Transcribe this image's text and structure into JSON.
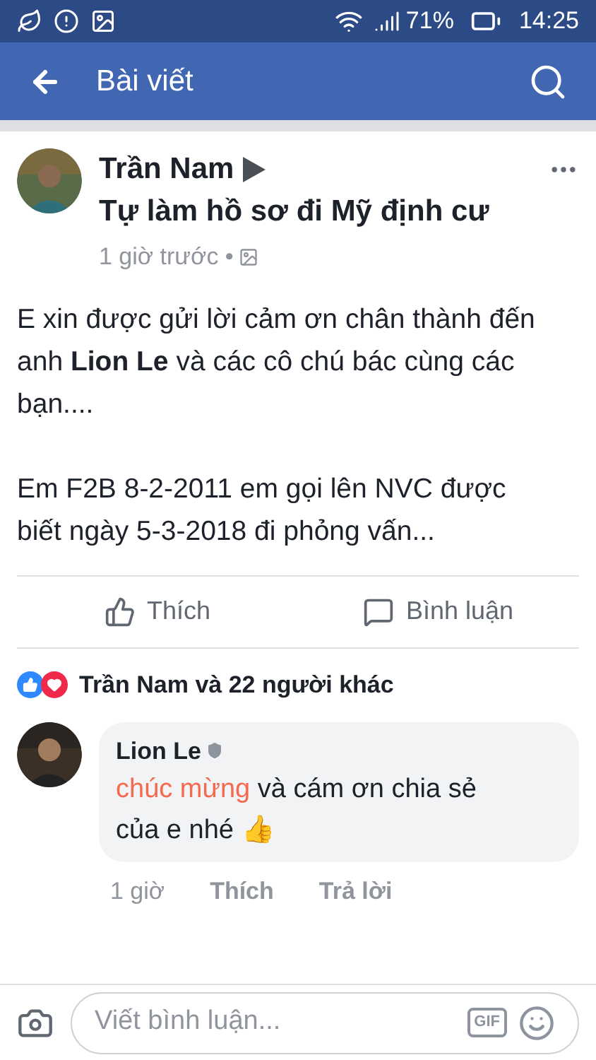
{
  "status_bar": {
    "battery": "71%",
    "time": "14:25"
  },
  "header": {
    "title": "Bài viết"
  },
  "post": {
    "author": "Trần Nam",
    "group": "Tự làm hồ sơ đi Mỹ định cư",
    "time": "1 giờ trước •",
    "paragraphs": [
      "E xin được gửi lời cảm ơn chân thành đến anh **Lion Le** và các cô chú bác cùng các bạn....",
      "Em F2B 8-2-2011 em gọi lên NVC được biết ngày 5-3-2018 đi phỏng vấn..."
    ],
    "actions": [
      "Thích",
      "Bình luận"
    ],
    "reactions": "Trần Nam và 22 người khác"
  },
  "comment": {
    "author": "Lion Le",
    "highlight": "chúc mừng",
    "text": " và cám ơn chia sẻ của e nhé",
    "emoji": "👍",
    "time": "1 giờ",
    "actions": [
      "Thích",
      "Trả lời"
    ]
  },
  "composer": {
    "placeholder": "Viết bình luận...",
    "gif": "GIF"
  }
}
